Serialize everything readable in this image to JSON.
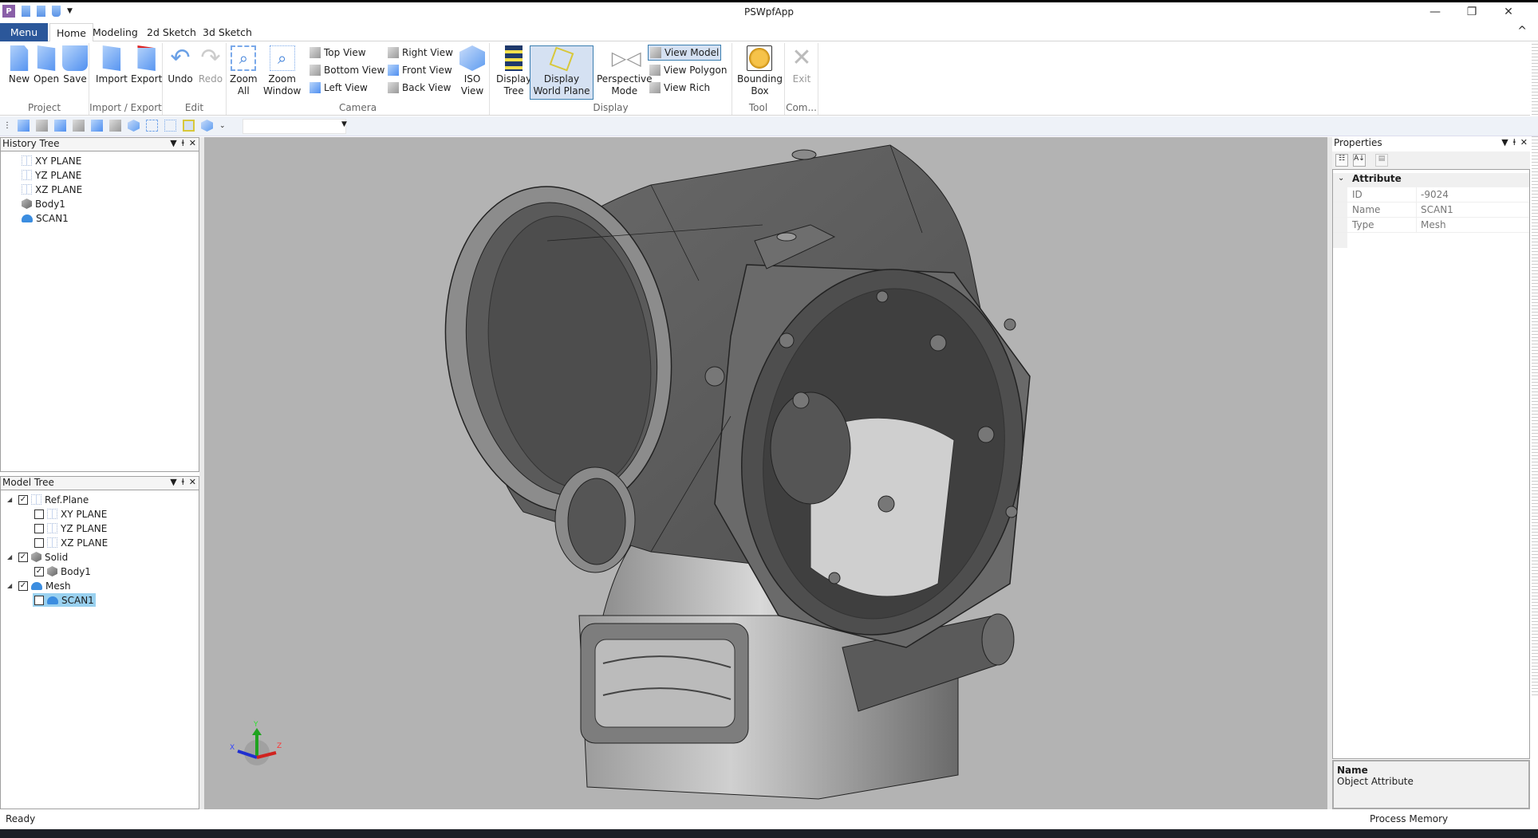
{
  "window": {
    "title": "PSWpfApp",
    "controls": {
      "minimize": "—",
      "restore": "❐",
      "close": "✕"
    },
    "quick_access": [
      "app-logo",
      "new-doc-icon",
      "open-doc-icon",
      "save-doc-icon",
      "customize-dropdown"
    ],
    "logo_text": "P"
  },
  "tabs": {
    "menu": "Menu",
    "items": [
      {
        "label": "Home",
        "active": true
      },
      {
        "label": "Modeling",
        "active": false
      },
      {
        "label": "2d Sketch",
        "active": false
      },
      {
        "label": "3d Sketch",
        "active": false
      }
    ],
    "collapse_icon": "^"
  },
  "ribbon": {
    "groups": {
      "project": {
        "label": "Project",
        "buttons": [
          "New",
          "Open",
          "Save"
        ]
      },
      "import_export": {
        "label": "Import / Export",
        "buttons": [
          "Import",
          "Export"
        ]
      },
      "edit": {
        "label": "Edit",
        "buttons": [
          "Undo",
          "Redo"
        ]
      },
      "camera": {
        "label": "Camera",
        "zoom_all": "Zoom\nAll",
        "zoom_all_1": "Zoom",
        "zoom_all_2": "All",
        "zoom_window_1": "Zoom",
        "zoom_window_2": "Window",
        "views": [
          "Top View",
          "Bottom View",
          "Left View",
          "Right View",
          "Front View",
          "Back View"
        ],
        "iso_1": "ISO",
        "iso_2": "View"
      },
      "display": {
        "label": "Display",
        "display_tree_1": "Display",
        "display_tree_2": "Tree",
        "world_plane_1": "Display",
        "world_plane_2": "World Plane",
        "perspective_1": "Perspective",
        "perspective_2": "Mode",
        "view_modes": [
          "View Model",
          "View Polygon",
          "View Rich"
        ],
        "selected_view_mode": "View Model"
      },
      "tool": {
        "label": "Tool",
        "bbox_1": "Bounding",
        "bbox_2": "Box"
      },
      "command": {
        "label": "Com...",
        "exit": "Exit"
      }
    }
  },
  "toolbar": {
    "icons": [
      "top-view-icon",
      "bottom-view-icon",
      "left-view-icon",
      "right-view-icon",
      "front-view-icon",
      "back-view-icon",
      "iso-view-icon",
      "zoom-all-icon",
      "zoom-window-icon",
      "world-plane-icon",
      "shading-icon"
    ],
    "combo_value": ""
  },
  "history_tree": {
    "title": "History Tree",
    "items": [
      {
        "label": "XY PLANE",
        "icon": "plane"
      },
      {
        "label": "YZ PLANE",
        "icon": "plane"
      },
      {
        "label": "XZ PLANE",
        "icon": "plane"
      },
      {
        "label": "Body1",
        "icon": "solid"
      },
      {
        "label": "SCAN1",
        "icon": "mesh"
      }
    ]
  },
  "model_tree": {
    "title": "Model Tree",
    "items": [
      {
        "label": "Ref.Plane",
        "level": 0,
        "checked": true,
        "expanded": true,
        "icon": "plane"
      },
      {
        "label": "XY PLANE",
        "level": 1,
        "checked": false,
        "icon": "plane"
      },
      {
        "label": "YZ PLANE",
        "level": 1,
        "checked": false,
        "icon": "plane"
      },
      {
        "label": "XZ PLANE",
        "level": 1,
        "checked": false,
        "icon": "plane"
      },
      {
        "label": "Solid",
        "level": 0,
        "checked": true,
        "expanded": true,
        "icon": "solid"
      },
      {
        "label": "Body1",
        "level": 1,
        "checked": true,
        "icon": "solid"
      },
      {
        "label": "Mesh",
        "level": 0,
        "checked": true,
        "expanded": true,
        "icon": "mesh"
      },
      {
        "label": "SCAN1",
        "level": 1,
        "checked": false,
        "icon": "mesh",
        "selected": true
      }
    ]
  },
  "viewport": {
    "axis_labels": {
      "x": "X",
      "y": "Y",
      "z": "Z"
    },
    "background": "#b3b3b3"
  },
  "properties": {
    "title": "Properties",
    "category": "Attribute",
    "rows": [
      {
        "key": "ID",
        "value": "-9024"
      },
      {
        "key": "Name",
        "value": "SCAN1"
      },
      {
        "key": "Type",
        "value": "Mesh"
      }
    ],
    "description_title": "Name",
    "description_text": "Object Attribute"
  },
  "status": {
    "left": "Ready",
    "right": "Process Memory"
  },
  "panel_controls": {
    "dropdown": "▼",
    "pin": "ⱡ",
    "close": "✕"
  },
  "colors": {
    "menu_tab": "#2b579a",
    "selection": "#d5e1f2",
    "selection_border": "#3c7fb1",
    "tree_selected": "#99d1f0"
  }
}
